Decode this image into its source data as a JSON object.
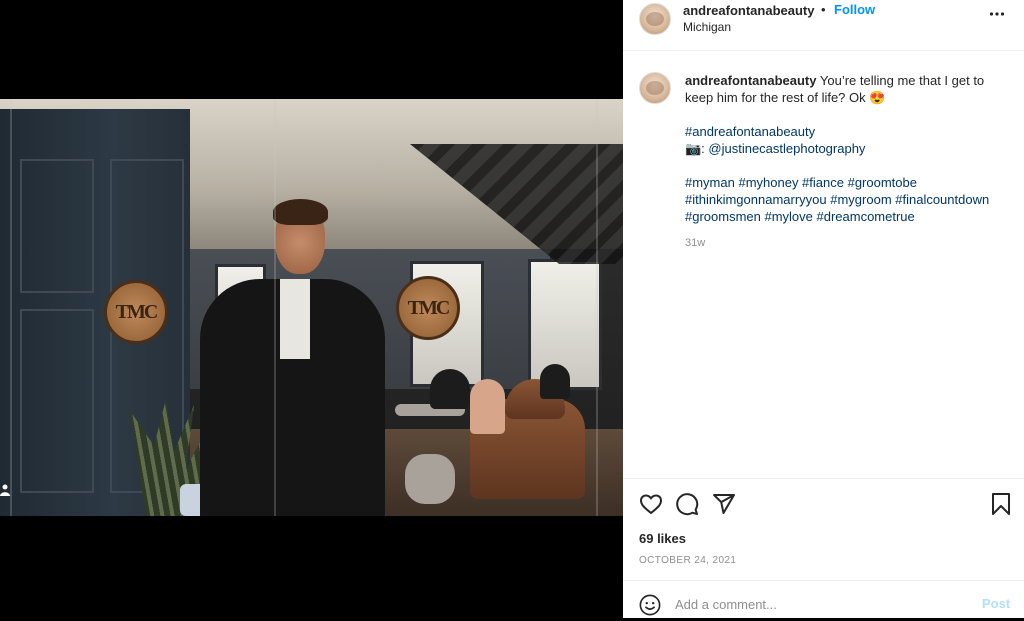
{
  "post": {
    "username": "andreafontanabeauty",
    "separator": "•",
    "follow_label": "Follow",
    "location": "Michigan",
    "more_icon": "more-horizontal-icon"
  },
  "caption": {
    "username": "andreafontanabeauty",
    "text": "You’re telling me that I get to keep him for the rest of life? Ok 😍",
    "hashtag_line1": "#andreafontanabeauty",
    "credit": "📷: @justinecastlephotography",
    "hashtags_block": "#myman #myhoney #fiance #groomtobe #ithinkimgonnamarryyou #mygroom #finalcountdown #groomsmen #mylove #dreamcometrue",
    "time": "31w"
  },
  "photo": {
    "logo_text": "TMC"
  },
  "actions": {
    "like_icon": "heart-icon",
    "comment_icon": "comment-bubble-icon",
    "share_icon": "paper-plane-icon",
    "save_icon": "bookmark-icon"
  },
  "stats": {
    "likes": "69 likes",
    "date": "OCTOBER 24, 2021"
  },
  "comment_box": {
    "placeholder": "Add a comment...",
    "post_label": "Post",
    "emoji_icon": "smiley-icon"
  },
  "colors": {
    "link_blue": "#0095f6",
    "hashtag": "#00376b",
    "post_disabled": "#b2dffc",
    "muted": "#8e8e8e"
  }
}
